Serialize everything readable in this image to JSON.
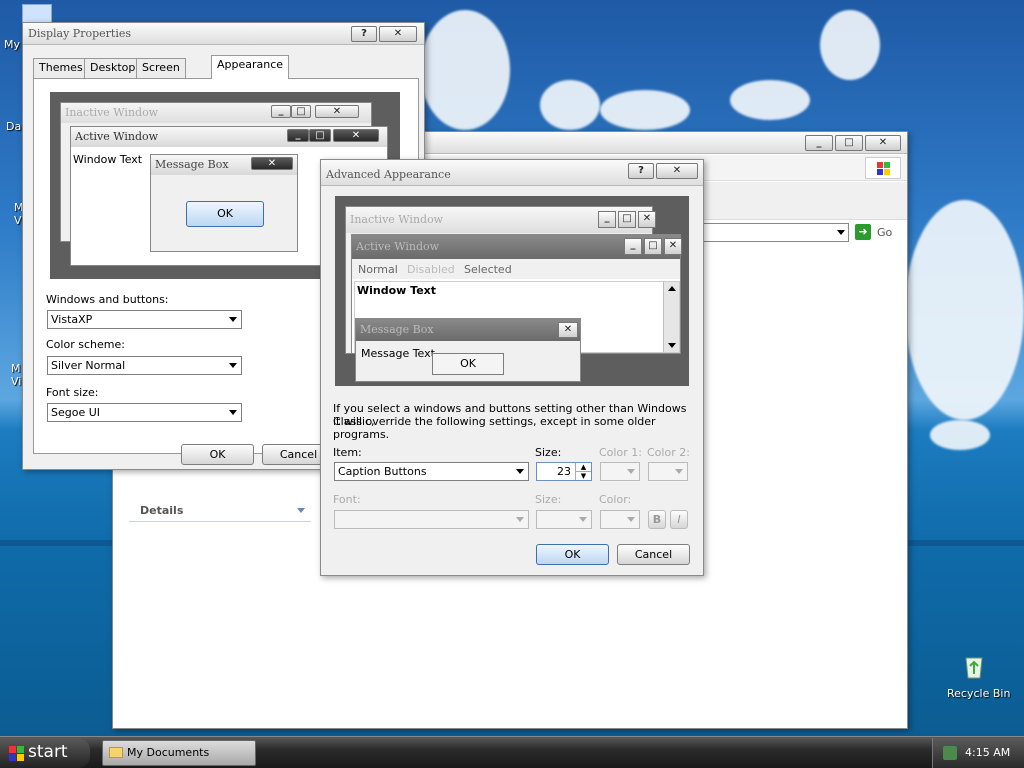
{
  "desktop": {
    "icon_labels": [
      "My",
      "Da",
      "M\nV",
      "M\nVi"
    ],
    "recycle_bin": "Recycle Bin"
  },
  "display_properties": {
    "title": "Display Properties",
    "title_help": "?",
    "title_close": "✕",
    "tabs": [
      "Themes",
      "Desktop",
      "Screen Saver",
      "Appearance"
    ],
    "preview": {
      "inactive_title": "Inactive Window",
      "active_title": "Active Window",
      "window_text": "Window Text",
      "message_box_title": "Message Box",
      "ok": "OK"
    },
    "windows_buttons_label": "Windows and buttons:",
    "windows_buttons_value": "VistaXP",
    "color_scheme_label": "Color scheme:",
    "color_scheme_value": "Silver Normal",
    "font_size_label": "Font size:",
    "font_size_value": "Segoe UI",
    "ok": "OK",
    "cancel": "Cancel"
  },
  "explorer": {
    "go_label": "Go",
    "details_label": "Details"
  },
  "advanced": {
    "title": "Advanced Appearance",
    "title_help": "?",
    "title_close": "✕",
    "preview": {
      "inactive_title": "Inactive Window",
      "active_title": "Active Window",
      "menu_normal": "Normal",
      "menu_disabled": "Disabled",
      "menu_selected": "Selected",
      "window_text": "Window Text",
      "message_box_title": "Message Box",
      "message_text": "Message Text",
      "ok": "OK"
    },
    "info_line1": "If you select a windows and buttons setting other than Windows Classic,",
    "info_line2": "it will override the following settings, except in some older programs.",
    "item_label": "Item:",
    "item_value": "Caption Buttons",
    "size_label": "Size:",
    "size_value": "23",
    "color1_label": "Color 1:",
    "color2_label": "Color 2:",
    "font_label": "Font:",
    "font_size_label": "Size:",
    "font_color_label": "Color:",
    "bold_label": "B",
    "italic_label": "I",
    "ok": "OK",
    "cancel": "Cancel"
  },
  "taskbar": {
    "start": "start",
    "task_item": "My Documents",
    "clock": "4:15 AM"
  }
}
